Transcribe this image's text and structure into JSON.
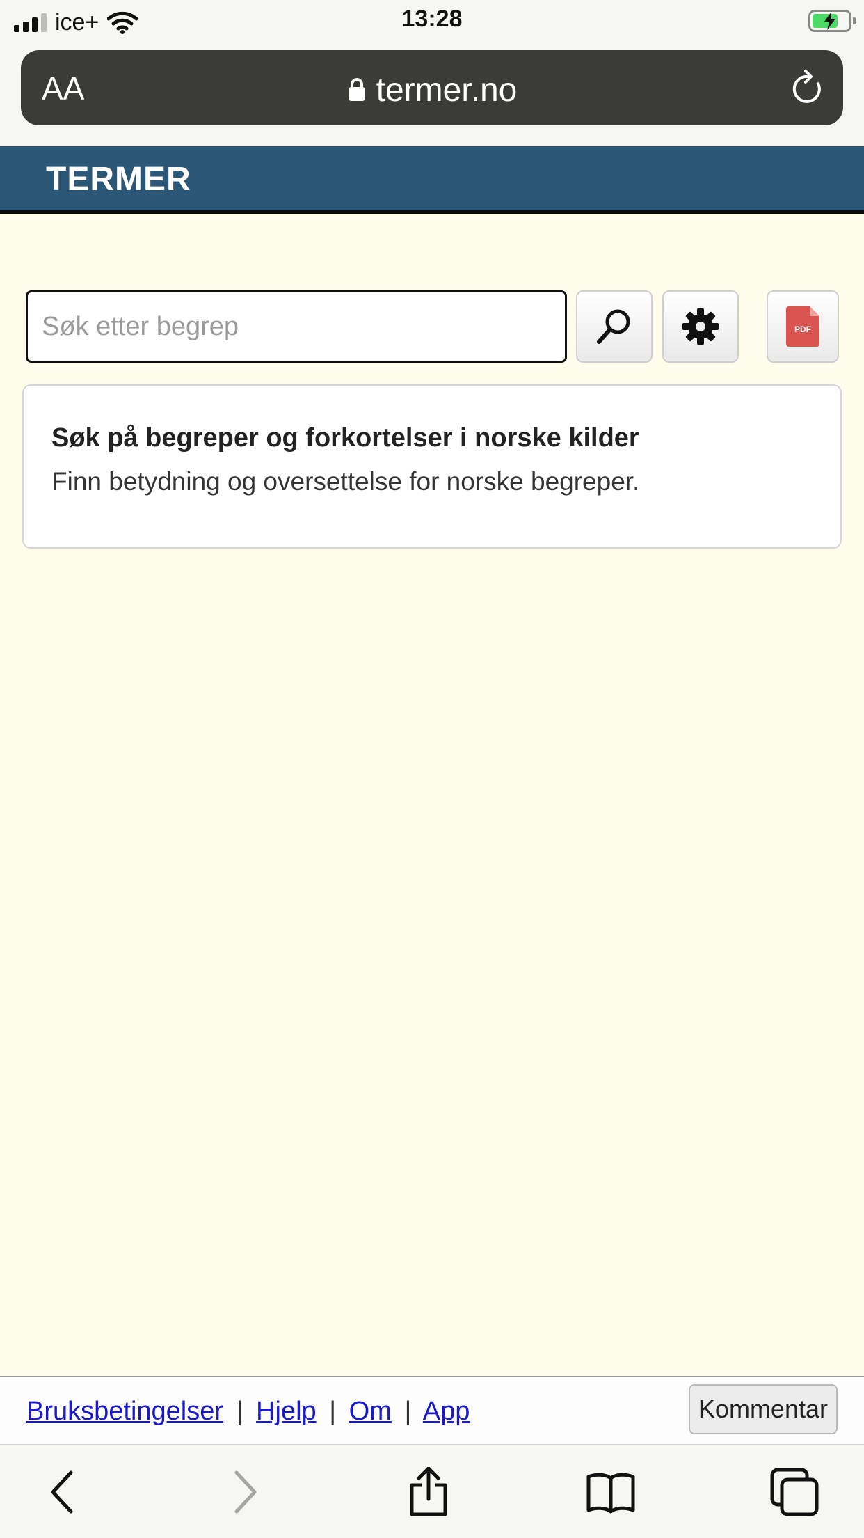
{
  "status_bar": {
    "carrier": "ice+",
    "time": "13:28"
  },
  "browser": {
    "text_size_label": "AA",
    "url": "termer.no"
  },
  "site": {
    "title": "TERMER"
  },
  "search": {
    "placeholder": "Søk etter begrep",
    "value": ""
  },
  "info": {
    "title": "Søk på begreper og forkortelser i norske kilder",
    "text": "Finn betydning og oversettelse for norske begreper."
  },
  "pdf_icon_label": "PDF",
  "footer": {
    "links": [
      "Bruksbetingelser",
      "Hjelp",
      "Om",
      "App"
    ],
    "separator": "|",
    "comment_label": "Kommentar"
  },
  "colors": {
    "header_bg": "#2c5675",
    "page_bg": "#fefdeb",
    "link": "#1a1acc",
    "pdf_red": "#d9534f"
  },
  "icons": {
    "toolbar": [
      "back-icon",
      "forward-icon",
      "share-icon",
      "bookmarks-icon",
      "tabs-icon"
    ],
    "tools": [
      "search-icon",
      "gear-icon",
      "pdf-icon"
    ]
  }
}
